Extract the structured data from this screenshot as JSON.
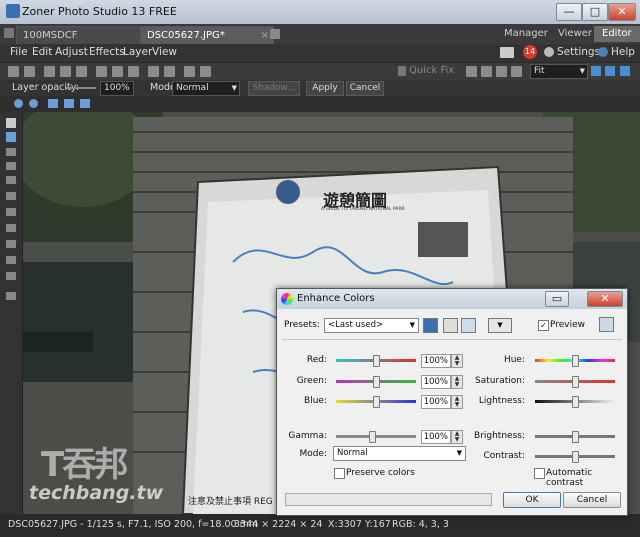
{
  "window": {
    "title": "Zoner Photo Studio 13 FREE",
    "minimize": "—",
    "maximize": "□",
    "close": "✕"
  },
  "tabs": [
    {
      "label": "100MSDCF"
    },
    {
      "label": "DSC05627.JPG*"
    }
  ],
  "modes": [
    "Manager",
    "Viewer",
    "Editor"
  ],
  "menu": [
    "File",
    "Edit",
    "Adjust",
    "Effects",
    "Layer",
    "View"
  ],
  "top_right": {
    "badge": "14",
    "settings": "Settings",
    "help": "Help"
  },
  "toolbar": {
    "quick_fix": "Quick Fix",
    "zoom": "Fit"
  },
  "options": {
    "layer_opacity_label": "Layer opacity:",
    "opacity_value": "100%",
    "mode_label": "Mode:",
    "mode_value": "Normal",
    "shadow": "Shadow...",
    "apply": "Apply",
    "cancel": "Cancel"
  },
  "image": {
    "sign_title": "遊憩簡圖",
    "sign_subtitle": "A GUIDE TO TAROKO NATIONAL PARK",
    "watermark_cn": "T吞邦",
    "watermark": "techbang.tw",
    "sign_bottom": "注意及禁止事項 REG"
  },
  "status": {
    "info": "DSC05627.JPG - 1/125 s, F7.1, ISO 200, f=18.00 mm",
    "size": "3344 × 2224 × 24",
    "coords": "X:3307 Y:167",
    "rgb": "RGB: 4, 3, 3"
  },
  "dialog": {
    "title": "Enhance Colors",
    "presets_label": "Presets:",
    "preset_value": "<Last used>",
    "preview": "Preview",
    "preview_checked": true,
    "left": [
      {
        "label": "Red:",
        "value": "100%",
        "level": 0.5,
        "gradient": [
          "#2ec4c4",
          "#e03030"
        ]
      },
      {
        "label": "Green:",
        "value": "100%",
        "level": 0.5,
        "gradient": [
          "#c030c0",
          "#30c030"
        ]
      },
      {
        "label": "Blue:",
        "value": "100%",
        "level": 0.5,
        "gradient": [
          "#e0e030",
          "#3030e0"
        ]
      },
      {
        "label": "Gamma:",
        "value": "100%",
        "level": 0.45,
        "gradient": [
          "#888888",
          "#888888"
        ]
      }
    ],
    "right": [
      {
        "label": "Hue:",
        "level": 0.5,
        "gradient": "hue"
      },
      {
        "label": "Saturation:",
        "level": 0.5,
        "gradient": [
          "#888888",
          "#e03030"
        ]
      },
      {
        "label": "Lightness:",
        "level": 0.5,
        "gradient": [
          "#111111",
          "#eeeeee"
        ]
      },
      {
        "label": "Brightness:",
        "level": 0.5,
        "gradient": [
          "#777777",
          "#777777"
        ]
      },
      {
        "label": "Contrast:",
        "level": 0.5,
        "gradient": [
          "#777777",
          "#777777"
        ]
      }
    ],
    "mode_label": "Mode:",
    "mode_value": "Normal",
    "preserve_colors": "Preserve colors",
    "automatic_contrast": "Automatic contrast",
    "ok": "OK",
    "cancel": "Cancel"
  }
}
